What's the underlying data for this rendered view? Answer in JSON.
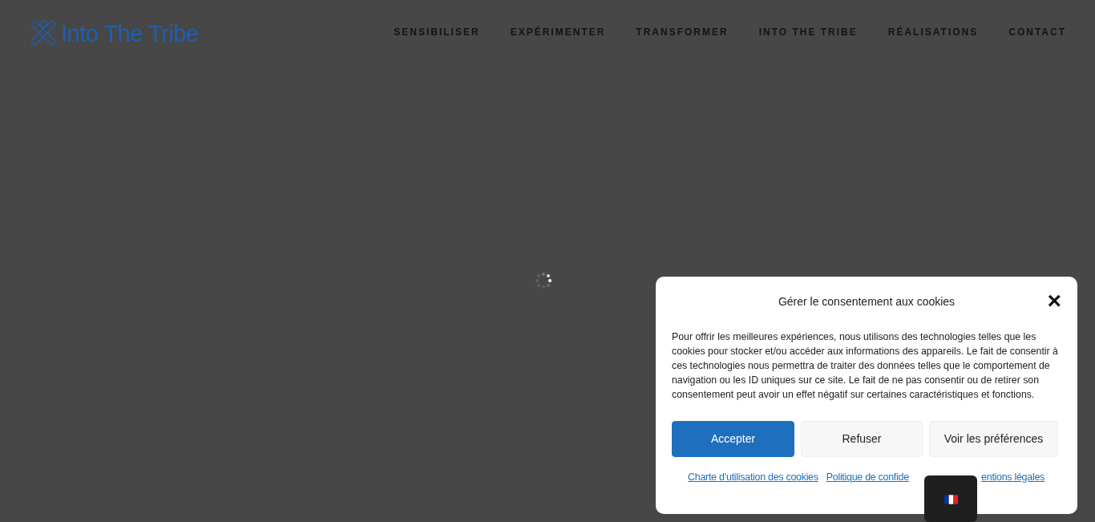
{
  "header": {
    "logo": "Into The Tribe",
    "menu": [
      {
        "label": "SENSIBILISER"
      },
      {
        "label": "EXPÉRIMENTER"
      },
      {
        "label": "TRANSFORMER"
      },
      {
        "label": "INTO THE TRIBE"
      },
      {
        "label": "RÉALISATIONS"
      },
      {
        "label": "CONTACT"
      }
    ]
  },
  "cookie_banner": {
    "title": "Gérer le consentement aux cookies",
    "close": "×",
    "text": "Pour offrir les meilleures expériences, nous utilisons des technologies telles que les cookies pour stocker et/ou accéder aux informations des appareils. Le fait de consentir à ces technologies nous permettra de traiter des données telles que le comportement de navigation ou les ID uniques sur ce site. Le fait de ne pas consentir ou de retirer son consentement peut avoir un effet négatif sur certaines caractéristiques et fonctions.",
    "buttons": [
      {
        "label": "Accepter",
        "kind": "primary"
      },
      {
        "label": "Refuser",
        "kind": "secondary"
      },
      {
        "label": "Voir les préférences",
        "kind": "secondary"
      }
    ],
    "links": [
      "Charte d’utilisation des cookies",
      "Politique de confide",
      "entions légales"
    ]
  }
}
